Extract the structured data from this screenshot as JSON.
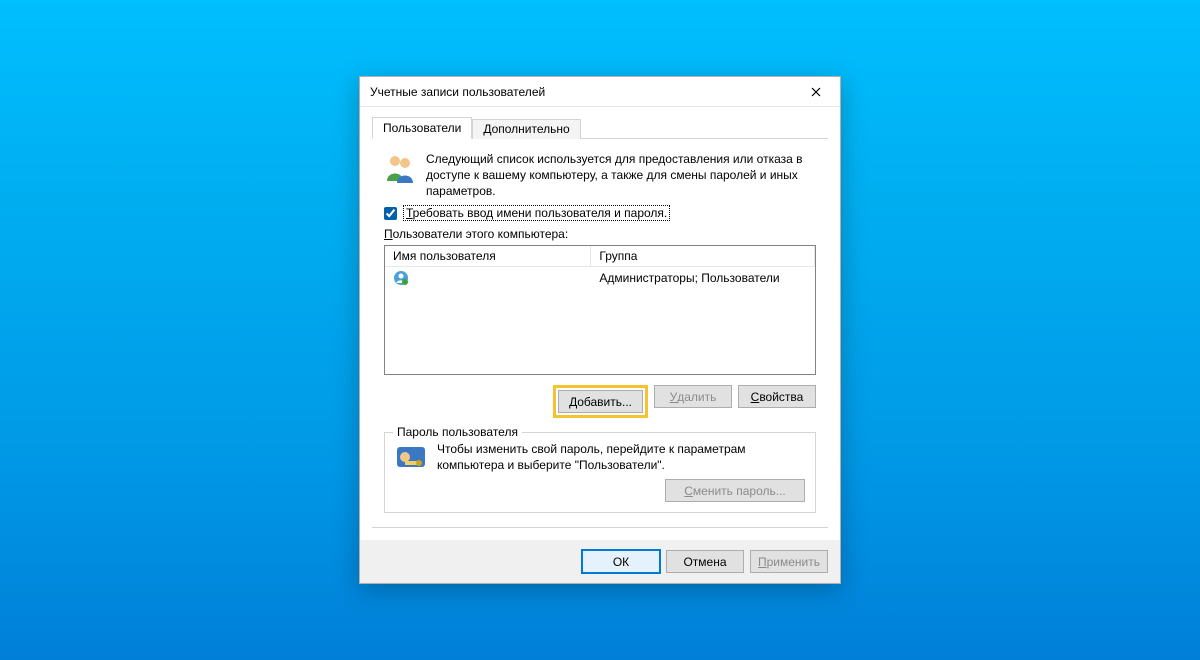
{
  "window_title": "Учетные записи пользователей",
  "tabs": {
    "users": "Пользователи",
    "advanced": "Дополнительно"
  },
  "description": "Следующий список используется для предоставления или отказа в доступе к вашему компьютеру, а также для смены паролей и иных параметров.",
  "checkbox": {
    "t": "Т",
    "rest": "ребовать ввод имени пользователя и пароля."
  },
  "users_label": {
    "p": "П",
    "rest": "ользователи этого компьютера:"
  },
  "table": {
    "col_user": "Имя пользователя",
    "col_group": "Группа",
    "row_user": "",
    "row_group": "Администраторы; Пользователи"
  },
  "buttons": {
    "add": {
      "d": "Д",
      "rest": "обавить..."
    },
    "remove": {
      "u": "У",
      "rest": "далить"
    },
    "properties": {
      "s": "С",
      "rest": "войства"
    }
  },
  "groupbox": {
    "legend": "Пароль пользователя",
    "text": "Чтобы изменить свой пароль, перейдите к параметрам компьютера и выберите \"Пользователи\".",
    "change": {
      "s": "С",
      "rest": "менить пароль..."
    }
  },
  "dialog_buttons": {
    "ok": "ОК",
    "cancel": "Отмена",
    "apply": {
      "p": "П",
      "rest": "рименить"
    }
  }
}
